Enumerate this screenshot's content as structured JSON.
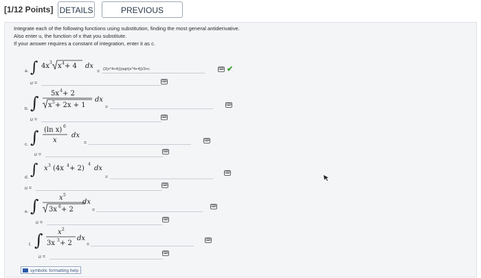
{
  "header": {
    "points": "[1/12 Points]",
    "details_label": "DETAILS",
    "previous_answers_label": "PREVIOUS ANSWERS"
  },
  "instructions": [
    "Integrate each of the following functions using substitution, finding the most general antiderivative.",
    "Also enter u, the function of x that you substitute.",
    "If your answer requires a constant of integration, enter it as c."
  ],
  "problems": [
    {
      "label": "a.",
      "integrand": {
        "coef": "4x",
        "coef_exp": "3",
        "radicand_x": "x",
        "radicand_exp": "4",
        "radicand_tail": " + 4",
        "dx": "dx"
      },
      "equals": "=",
      "answer": "(2(x^4+4))(sqrt(x^4+4))/3+c",
      "u_label": "u =",
      "u_value": "",
      "correct": true
    },
    {
      "label": "b.",
      "integrand": {
        "num": "5x",
        "num_exp": "4",
        "num_tail": " + 2",
        "den_a": "x",
        "den_exp": "5",
        "den_tail": " + 2x + 1",
        "dx": "dx"
      },
      "equals": "=",
      "answer": "",
      "u_label": "u =",
      "u_value": ""
    },
    {
      "label": "c.",
      "integrand": {
        "num": "(ln x)",
        "num_exp": "6",
        "den": "x",
        "dx": "dx"
      },
      "equals": "=",
      "answer": "",
      "u_label": "u =",
      "u_value": ""
    },
    {
      "label": "d.",
      "integrand": {
        "a": "x",
        "a_exp": "3",
        "b": "(4x",
        "b_exp": "4",
        "b_tail": " + 2)",
        "outer_exp": "4",
        "dx": "dx"
      },
      "equals": "=",
      "answer": "",
      "u_label": "u =",
      "u_value": ""
    },
    {
      "label": "e.",
      "integrand": {
        "num": "x",
        "num_exp": "5",
        "den_a": "3x",
        "den_exp": "6",
        "den_tail": " + 2",
        "dx": "dx"
      },
      "equals": "=",
      "answer": "",
      "u_label": "u =",
      "u_value": ""
    },
    {
      "label": "f.",
      "integrand": {
        "num": "x",
        "num_exp": "2",
        "den_a": "3x",
        "den_exp": "3",
        "den_tail": " + 2",
        "dx": "dx"
      },
      "equals": "=",
      "answer": "",
      "u_label": "u =",
      "u_value": ""
    }
  ],
  "keypad_icon": "keyboard-icon",
  "help_label": "symbolic formatting help",
  "colors": {
    "check": "#3f9c35",
    "panel": "#f4f5f7",
    "button_border": "#9aa5b3"
  }
}
